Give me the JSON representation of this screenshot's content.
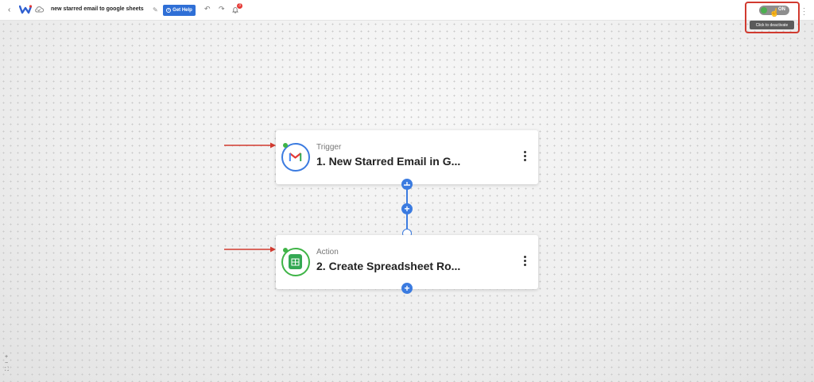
{
  "topbar": {
    "back_icon": "chevron-left-icon",
    "logo_icon": "w-logo-icon",
    "cloud_icon": "cloud-icon",
    "workflow_title": "new starred email to google sheets",
    "edit_icon": "pencil-icon",
    "help_label": "Get Help",
    "undo_icon": "undo-icon",
    "redo_icon": "redo-icon",
    "notifications_icon": "bell-icon",
    "notifications_count": "3",
    "more_icon": "vertical-dots-icon"
  },
  "activation": {
    "state_label": "ON",
    "tooltip": "Click to deactivate",
    "knob_color": "#4caf50",
    "highlight_color": "#d13a2f"
  },
  "nodes": [
    {
      "type": "Trigger",
      "title": "1. New Starred Email in G...",
      "app_icon": "gmail-icon",
      "ring_color": "#3b7be0"
    },
    {
      "type": "Action",
      "title": "2. Create Spreadsheet Ro...",
      "app_icon": "google-sheets-icon",
      "ring_color": "#3fb447"
    }
  ],
  "annotation_color": "#d13a2f",
  "accent_color": "#3b7be0",
  "zoom": {
    "zoom_in": "+",
    "zoom_out": "−",
    "fit": "⛶"
  }
}
